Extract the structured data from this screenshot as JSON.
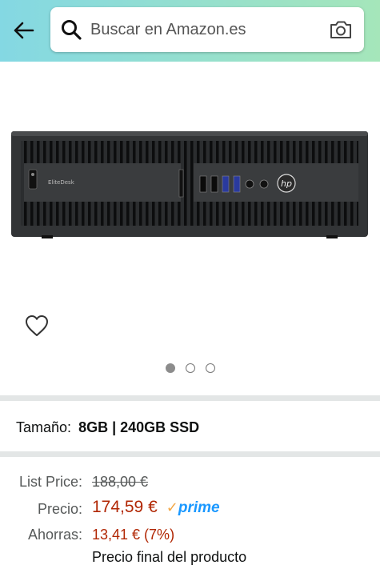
{
  "header": {
    "back_icon": "arrow-left-icon",
    "search_placeholder": "Buscar en Amazon.es",
    "search_icon": "search-icon",
    "camera_icon": "camera-icon",
    "gradient": [
      "#84d8e3",
      "#a5e6ba"
    ]
  },
  "product": {
    "image_brand_label": "EliteDesk",
    "image_logo": "hp",
    "carousel_total": 3,
    "carousel_active": 1
  },
  "variant": {
    "label": "Tamaño:",
    "value": "8GB | 240GB SSD"
  },
  "pricing": {
    "list_price_label": "List Price:",
    "list_price_value": "188,00 €",
    "price_label": "Precio:",
    "price_value": "174,59 €",
    "prime_check": "✓",
    "prime_word": "prime",
    "savings_label": "Ahorras:",
    "savings_value": "13,41 € (7%)",
    "final_note": "Precio final del producto"
  },
  "colors": {
    "price_red": "#b12704",
    "prime_blue": "#1a98ff",
    "prime_orange": "#f3a847"
  }
}
